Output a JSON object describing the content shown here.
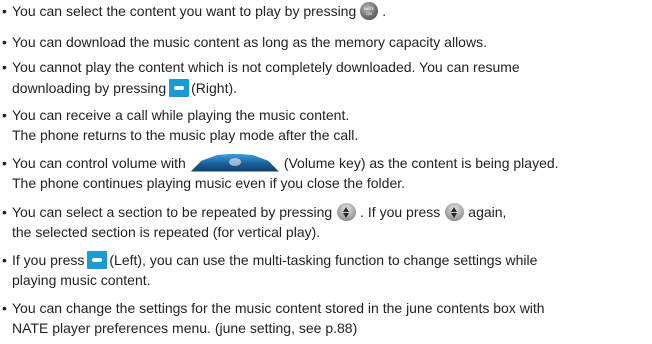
{
  "bullets": [
    {
      "segments": [
        "You can select the content you want to play by pressing",
        "."
      ],
      "continuation": [],
      "icon": "nate-ok-key-icon",
      "icon_text": [
        "NATE",
        "OK"
      ]
    },
    {
      "segments": [
        "You can download the music content as long as the memory capacity allows."
      ],
      "continuation": []
    },
    {
      "segments": [
        "You cannot play the content which is not completely downloaded. You can resume"
      ],
      "continuation": [
        "downloading by pressing",
        "(Right)."
      ],
      "icon": "soft-key-right-icon"
    },
    {
      "segments": [
        "You can receive a call while playing the music content."
      ],
      "continuation": [
        "The phone returns to the music play mode after the call."
      ]
    },
    {
      "segments": [
        "You can control volume with",
        "(Volume key) as the content is being played."
      ],
      "continuation": [
        "The phone continues playing music even if you close the folder."
      ],
      "icon": "volume-key-icon"
    },
    {
      "segments": [
        "You can select a section to be repeated by pressing",
        ". If you press",
        "again,"
      ],
      "continuation": [
        "the selected section is repeated (for vertical play)."
      ],
      "icon": "navigation-key-icon"
    },
    {
      "segments": [
        "If you press",
        "(Left), you can use the multi-tasking function to change settings while"
      ],
      "continuation": [
        "playing music content."
      ],
      "icon": "soft-key-left-icon"
    },
    {
      "segments": [
        "You can change the settings for the music content stored in the june contents box with"
      ],
      "continuation": [
        "NATE player preferences menu. (june setting, see p.88)"
      ]
    }
  ],
  "colors": {
    "text": "#231f20",
    "soft_key": "#1b9bd4",
    "volume_key": "#1a5f9a"
  }
}
